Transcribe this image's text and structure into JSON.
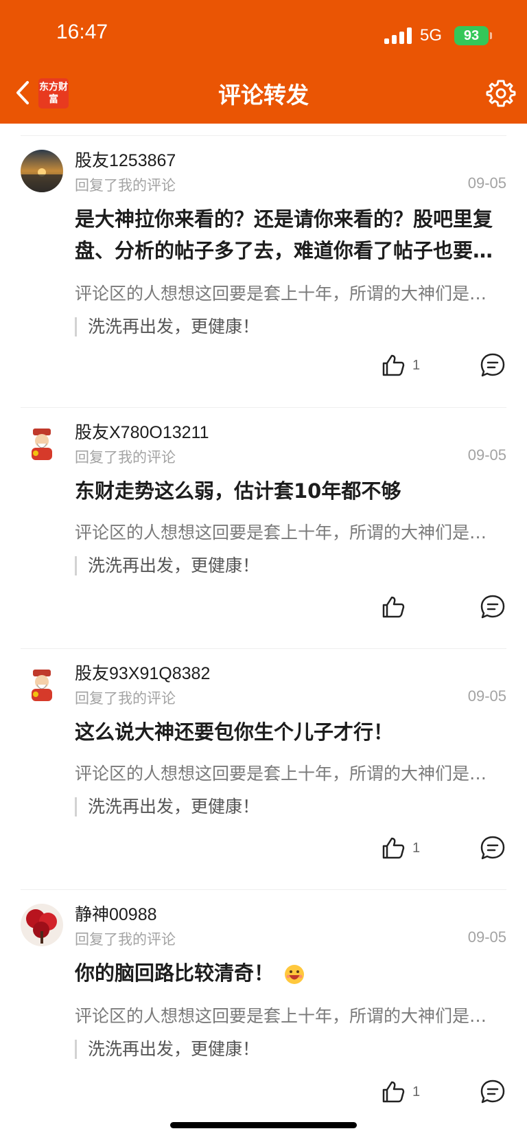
{
  "status_bar": {
    "time": "16:47",
    "network": "5G",
    "battery": "93"
  },
  "header": {
    "title": "评论转发",
    "brand_logo": "东方财富"
  },
  "icons": {
    "back": "chevron-left-icon",
    "settings": "gear-icon",
    "like": "thumbs-up-icon",
    "comment": "comment-bubble-icon"
  },
  "colors": {
    "header_bg": "#ea5504",
    "battery": "#34c759"
  },
  "comments": [
    {
      "username": "股友1253867",
      "subtitle": "回复了我的评论",
      "date": "09-05",
      "reply": "是大神拉你来看的？还是请你来看的？股吧里复盘、分析的帖子多了去，难道你看了帖子也要他们给你包一个大红包吗？",
      "original": "评论区的人想想这回要是套上十年，所谓的大神们是不是要给我们包个大红包",
      "quote": "洗洗再出发，更健康！",
      "likes": "1"
    },
    {
      "username": "股友X780O13211",
      "subtitle": "回复了我的评论",
      "date": "09-05",
      "reply": "东财走势这么弱，估计套10年都不够",
      "original": "评论区的人想想这回要是套上十年，所谓的大神们是不是要给我们包个大红包",
      "quote": "洗洗再出发，更健康！",
      "likes": ""
    },
    {
      "username": "股友93X91Q8382",
      "subtitle": "回复了我的评论",
      "date": "09-05",
      "reply": "这么说大神还要包你生个儿子才行！",
      "original": "评论区的人想想这回要是套上十年，所谓的大神们是不是要给我们包个大红包",
      "quote": "洗洗再出发，更健康！",
      "likes": "1"
    },
    {
      "username": "静神00988",
      "subtitle": "回复了我的评论",
      "date": "09-05",
      "reply": "你的脑回路比较清奇！",
      "original": "评论区的人想想这回要是套上十年，所谓的大神们是不是要给我们包个大红包",
      "quote": "洗洗再出发，更健康！",
      "likes": "1"
    }
  ]
}
